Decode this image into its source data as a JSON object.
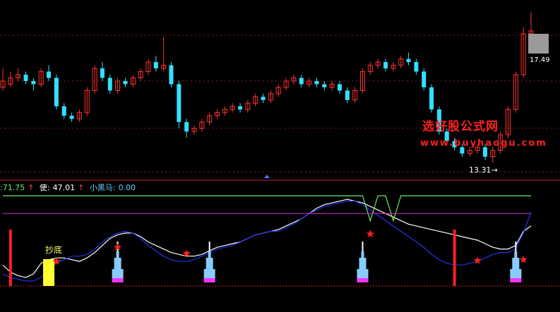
{
  "readouts": {
    "v1": ":71.75",
    "v2_label": "使:",
    "v2": "47.01",
    "v3_label": "小黑马:",
    "v3": "0.00",
    "up_arrow": "↑"
  },
  "labels": {
    "high_price": "17.49",
    "low_price": "13.31→",
    "signal": "抄底",
    "watermark_cn": "选好股公式网",
    "watermark_url": "www.buyhaogu.com"
  },
  "colors": {
    "background": "#000000",
    "up_candle": "#ff3333",
    "down_candle": "#33e0ff",
    "white_line": "#ffffff",
    "blue_line": "#2233ee",
    "green_line": "#66ee66",
    "magenta_line": "#cc22cc",
    "red_bar": "#ff2020",
    "yellow_bar": "#ffff33",
    "stack_cyan": "#88ccff",
    "stack_magenta": "#ff33ff",
    "star": "#ff2020"
  },
  "chart_data": [
    {
      "type": "candlestick",
      "description_source": "price panel",
      "candles": [
        [
          15.7,
          15.9,
          16.3,
          15.6
        ],
        [
          15.8,
          16.0,
          16.2,
          15.7
        ],
        [
          16.0,
          16.1,
          16.3,
          15.9
        ],
        [
          16.1,
          15.9,
          16.2,
          15.8
        ],
        [
          15.9,
          15.8,
          16.0,
          15.6
        ],
        [
          15.8,
          16.2,
          16.3,
          15.7
        ],
        [
          16.2,
          16.0,
          16.4,
          15.9
        ],
        [
          16.0,
          15.1,
          16.1,
          15.0
        ],
        [
          15.1,
          14.8,
          15.2,
          14.7
        ],
        [
          14.8,
          14.7,
          14.9,
          14.6
        ],
        [
          14.7,
          14.9,
          15.0,
          14.6
        ],
        [
          14.9,
          15.6,
          15.7,
          14.8
        ],
        [
          15.6,
          16.3,
          16.4,
          15.5
        ],
        [
          16.3,
          16.0,
          16.5,
          15.9
        ],
        [
          16.0,
          15.6,
          16.1,
          15.5
        ],
        [
          15.6,
          15.9,
          16.0,
          15.5
        ],
        [
          15.9,
          15.8,
          16.0,
          15.7
        ],
        [
          15.8,
          16.0,
          16.1,
          15.7
        ],
        [
          16.0,
          16.2,
          16.3,
          15.9
        ],
        [
          16.2,
          16.5,
          16.6,
          16.1
        ],
        [
          16.5,
          16.3,
          16.7,
          16.2
        ],
        [
          16.3,
          16.4,
          17.3,
          16.2
        ],
        [
          16.4,
          15.8,
          16.5,
          15.7
        ],
        [
          15.8,
          14.6,
          15.9,
          14.4
        ],
        [
          14.6,
          14.3,
          14.7,
          14.1
        ],
        [
          14.3,
          14.4,
          14.5,
          14.2
        ],
        [
          14.4,
          14.6,
          14.7,
          14.3
        ],
        [
          14.6,
          14.8,
          14.9,
          14.5
        ],
        [
          14.8,
          14.9,
          15.0,
          14.7
        ],
        [
          14.9,
          15.0,
          15.1,
          14.8
        ],
        [
          15.0,
          15.1,
          15.2,
          14.9
        ],
        [
          15.1,
          15.0,
          15.2,
          14.9
        ],
        [
          15.0,
          15.2,
          15.3,
          14.9
        ],
        [
          15.2,
          15.4,
          15.5,
          15.1
        ],
        [
          15.4,
          15.3,
          15.5,
          15.2
        ],
        [
          15.3,
          15.5,
          15.6,
          15.2
        ],
        [
          15.5,
          15.7,
          15.8,
          15.4
        ],
        [
          15.7,
          15.9,
          16.0,
          15.6
        ],
        [
          15.9,
          16.0,
          16.1,
          15.8
        ],
        [
          16.0,
          15.8,
          16.1,
          15.7
        ],
        [
          15.8,
          15.9,
          16.0,
          15.7
        ],
        [
          15.9,
          15.8,
          16.0,
          15.7
        ],
        [
          15.8,
          15.7,
          15.9,
          15.6
        ],
        [
          15.7,
          15.8,
          15.9,
          15.6
        ],
        [
          15.8,
          15.6,
          15.9,
          15.5
        ],
        [
          15.6,
          15.3,
          15.7,
          15.2
        ],
        [
          15.3,
          15.6,
          15.7,
          15.2
        ],
        [
          15.6,
          16.2,
          16.3,
          15.5
        ],
        [
          16.2,
          16.4,
          16.5,
          16.1
        ],
        [
          16.4,
          16.5,
          16.6,
          16.3
        ],
        [
          16.5,
          16.3,
          16.6,
          16.2
        ],
        [
          16.3,
          16.4,
          16.5,
          16.2
        ],
        [
          16.4,
          16.6,
          16.7,
          16.3
        ],
        [
          16.6,
          16.5,
          16.8,
          16.4
        ],
        [
          16.5,
          16.2,
          16.6,
          16.1
        ],
        [
          16.2,
          15.7,
          16.3,
          15.6
        ],
        [
          15.7,
          15.0,
          15.8,
          14.9
        ],
        [
          15.0,
          14.3,
          15.1,
          14.2
        ],
        [
          14.3,
          14.0,
          14.4,
          13.9
        ],
        [
          14.0,
          13.8,
          14.1,
          13.7
        ],
        [
          13.8,
          13.6,
          13.9,
          13.5
        ],
        [
          13.6,
          13.7,
          13.8,
          13.5
        ],
        [
          13.7,
          13.8,
          13.9,
          13.6
        ],
        [
          13.8,
          13.5,
          13.9,
          13.4
        ],
        [
          13.5,
          13.7,
          13.8,
          13.31
        ],
        [
          13.7,
          14.2,
          14.3,
          13.6
        ],
        [
          14.2,
          15.0,
          15.1,
          14.1
        ],
        [
          15.0,
          16.1,
          16.2,
          14.9
        ],
        [
          16.1,
          17.4,
          17.6,
          16.0
        ],
        [
          17.4,
          17.49,
          18.1,
          17.3
        ]
      ],
      "y_reference": [
        17.49,
        13.31
      ]
    },
    {
      "type": "line",
      "description_source": "indicator panel",
      "ylim": [
        0,
        100
      ],
      "series": [
        {
          "color": "#ffffff",
          "values": [
            22,
            14,
            10,
            8,
            12,
            24,
            28,
            30,
            30,
            28,
            26,
            30,
            36,
            44,
            52,
            56,
            58,
            58,
            54,
            48,
            44,
            40,
            36,
            34,
            32,
            32,
            34,
            38,
            42,
            44,
            46,
            48,
            52,
            56,
            58,
            60,
            62,
            66,
            70,
            74,
            80,
            86,
            90,
            92,
            94,
            96,
            94,
            92,
            88,
            84,
            80,
            76,
            72,
            68,
            66,
            64,
            62,
            60,
            58,
            56,
            54,
            52,
            50,
            46,
            42,
            40,
            40,
            44,
            60,
            66
          ]
        },
        {
          "color": "#2233ee",
          "values": [
            12,
            8,
            6,
            4,
            4,
            8,
            16,
            24,
            28,
            32,
            32,
            34,
            40,
            48,
            54,
            58,
            60,
            58,
            52,
            44,
            38,
            32,
            28,
            26,
            26,
            28,
            32,
            36,
            40,
            42,
            44,
            48,
            52,
            56,
            58,
            60,
            60,
            64,
            68,
            74,
            80,
            84,
            88,
            90,
            92,
            94,
            94,
            90,
            84,
            78,
            72,
            66,
            60,
            54,
            48,
            42,
            34,
            28,
            24,
            22,
            22,
            24,
            26,
            30,
            34,
            36,
            36,
            40,
            58,
            82
          ]
        },
        {
          "color": "#66ee66",
          "values": [
            100,
            100,
            100,
            100,
            100,
            100,
            100,
            100,
            100,
            100,
            100,
            100,
            100,
            100,
            100,
            100,
            100,
            100,
            100,
            100,
            100,
            100,
            100,
            100,
            100,
            100,
            100,
            100,
            100,
            100,
            100,
            100,
            100,
            100,
            100,
            100,
            100,
            100,
            100,
            100,
            100,
            100,
            100,
            100,
            100,
            100,
            100,
            100,
            72,
            100,
            100,
            72,
            100,
            100,
            100,
            100,
            100,
            100,
            100,
            100,
            100,
            100,
            100,
            100,
            100,
            100,
            100,
            100,
            100,
            100
          ]
        },
        {
          "color": "#cc22cc",
          "values": [
            80,
            80,
            80,
            80,
            80,
            80,
            80,
            80,
            80,
            80,
            80,
            80,
            80,
            80,
            80,
            80,
            80,
            80,
            80,
            80,
            80,
            80,
            80,
            80,
            80,
            80,
            80,
            80,
            80,
            80,
            80,
            80,
            80,
            80,
            80,
            80,
            80,
            80,
            80,
            80,
            80,
            80,
            80,
            80,
            80,
            80,
            80,
            80,
            80,
            80,
            80,
            80,
            80,
            80,
            80,
            80,
            80,
            80,
            80,
            80,
            80,
            80,
            80,
            80,
            80,
            80,
            80,
            80,
            80,
            80
          ]
        }
      ],
      "red_bars": [
        1,
        59
      ],
      "yellow_bar": 6,
      "stacks": [
        15,
        27,
        47,
        67
      ],
      "stars": [
        [
          7,
          26
        ],
        [
          15,
          42
        ],
        [
          24,
          35
        ],
        [
          48,
          57
        ],
        [
          62,
          27
        ],
        [
          68,
          28
        ]
      ]
    }
  ]
}
